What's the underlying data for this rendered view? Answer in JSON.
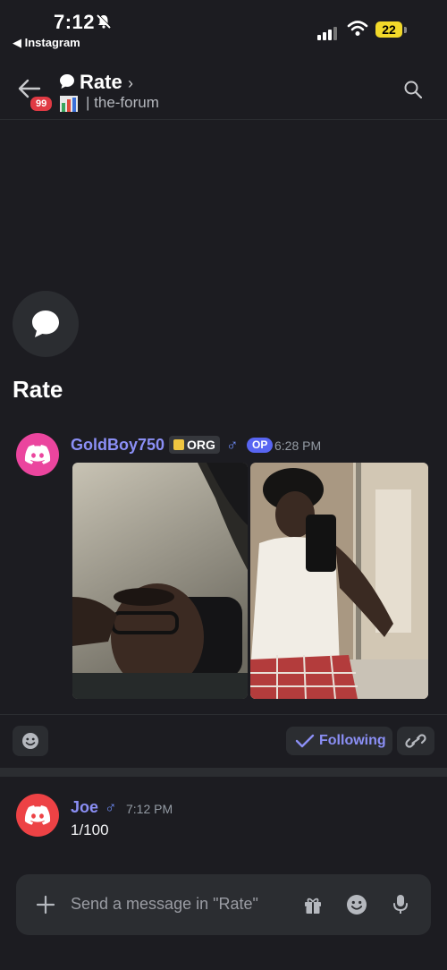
{
  "status_bar": {
    "time": "7:12",
    "back_app": "◀ Instagram",
    "battery": "22"
  },
  "header": {
    "channel_title": "Rate",
    "chevron": "›",
    "unread_count": "99",
    "subtitle": "| the-forum"
  },
  "post": {
    "title": "Rate"
  },
  "message1": {
    "author": "GoldBoy750",
    "tag": "ORG",
    "gender_symbol": "♂",
    "op_label": "OP",
    "time": "6:28 PM"
  },
  "actions": {
    "following_label": "Following"
  },
  "message2": {
    "author": "Joe",
    "gender_symbol": "♂",
    "time": "7:12 PM",
    "text": "1/100"
  },
  "composer": {
    "placeholder": "Send a message in \"Rate\""
  },
  "colors": {
    "background": "#1c1c21",
    "accent": "#5865f2",
    "author_name": "#8b8ff5",
    "avatar_pink": "#eb459e",
    "avatar_red": "#ed4245"
  },
  "icons": [
    "back-arrow-icon",
    "search-icon",
    "chat-bubble-icon",
    "discord-icon",
    "smiley-icon",
    "checkmark-icon",
    "link-icon",
    "plus-icon",
    "gift-icon",
    "microphone-icon",
    "bell-slash-icon",
    "wifi-icon"
  ]
}
